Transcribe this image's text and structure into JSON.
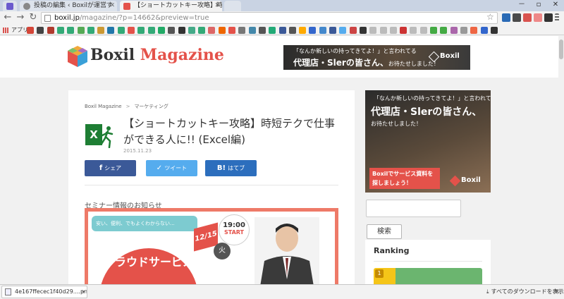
{
  "browser": {
    "tabs": [
      {
        "label": "",
        "favicon": "#6a5acd"
      },
      {
        "label": "投稿の編集 ‹ Boxilが運営す",
        "favicon": "#888888"
      },
      {
        "label": "【ショートカットキー攻略】時短",
        "favicon": "#e4524a"
      }
    ],
    "window_controls": [
      "－",
      "▫",
      "✕"
    ],
    "url_host": "boxil.jp",
    "url_path": "/magazine/?p=14662&preview=true",
    "back_icon": "←",
    "forward_icon": "→",
    "reload_icon": "↻",
    "star_icon": "☆",
    "bookmarks_apps_label": "アプリ",
    "extension_colors": [
      "#2a6ab5",
      "#4a4a4a",
      "#d9534f",
      "#e88",
      "#333",
      "#666"
    ],
    "bookmark_colors": [
      "#d44638",
      "#444",
      "#b03a2e",
      "#3a7",
      "#3a7",
      "#5a5",
      "#3a7",
      "#c93",
      "#27a",
      "#3a7",
      "#e4524a",
      "#3a7",
      "#3a7",
      "#2a6",
      "#555",
      "#333",
      "#4a8",
      "#3a7",
      "#d66",
      "#e60",
      "#e4524a",
      "#777",
      "#48a",
      "#555",
      "#2a7",
      "#3b5998",
      "#555",
      "#fa0",
      "#36c",
      "#48c",
      "#3b5998",
      "#55acee",
      "#c44",
      "#333",
      "#bbb",
      "#bbb",
      "#bbb",
      "#c33",
      "#bbb",
      "#bbb",
      "#4a4",
      "#4a4",
      "#a6a",
      "#999",
      "#e64",
      "#36c",
      "#333"
    ]
  },
  "header": {
    "logo_brand": "Boxil",
    "logo_accent": "Magazine",
    "banner": {
      "line1": "「なんか新しいの持ってきてよ！」と言われてる",
      "line2": "代理店・Slerの皆さん、",
      "line2_small": "お待たせしました！",
      "brand": "Boxil"
    }
  },
  "article": {
    "breadcrumb_home": "Boxil Magazine",
    "breadcrumb_sep": ">",
    "breadcrumb_category": "マーケティング",
    "title": "【ショートカットキー攻略】時短テクで仕事ができる人に!! (Excel編)",
    "date": "2015.11.23",
    "share": {
      "facebook_glyph": "f",
      "facebook": "シェア",
      "twitter_glyph": "✓",
      "twitter": "ツイート",
      "hatena_glyph": "B!",
      "hatena": "はてブ"
    },
    "seminar_heading": "セミナー情報のお知らせ",
    "seminar": {
      "bubble": "安い、便利、でもよくわからない...",
      "date": "12/15",
      "weekday": "火",
      "time": "19:00",
      "start": "START",
      "cloud_text": "クラウドサービス"
    }
  },
  "sidebar": {
    "ad": {
      "line1": "「なんか新しいの持ってきてよ！」と言われてる",
      "line2": "代理店・Slerの皆さん、",
      "line3": "お待たせしました！",
      "cta": "Boxilでサービス資料を探しましょう！",
      "brand": "Boxil"
    },
    "search_value": "",
    "search_button": "検索",
    "ranking_title": "Ranking",
    "ranking_first_num": "1"
  },
  "downloads": {
    "file_name": "4e167ffecec1f40d29....png",
    "menu_arrow": "▾",
    "show_all_icon": "⤓",
    "show_all": "すべてのダウンロードを表示",
    "close_icon": "✕"
  },
  "colors": {
    "accent": "#e4524a",
    "facebook": "#3b5998",
    "twitter": "#55acee",
    "hatena": "#2c6ebd",
    "excel": "#1e7e34"
  }
}
